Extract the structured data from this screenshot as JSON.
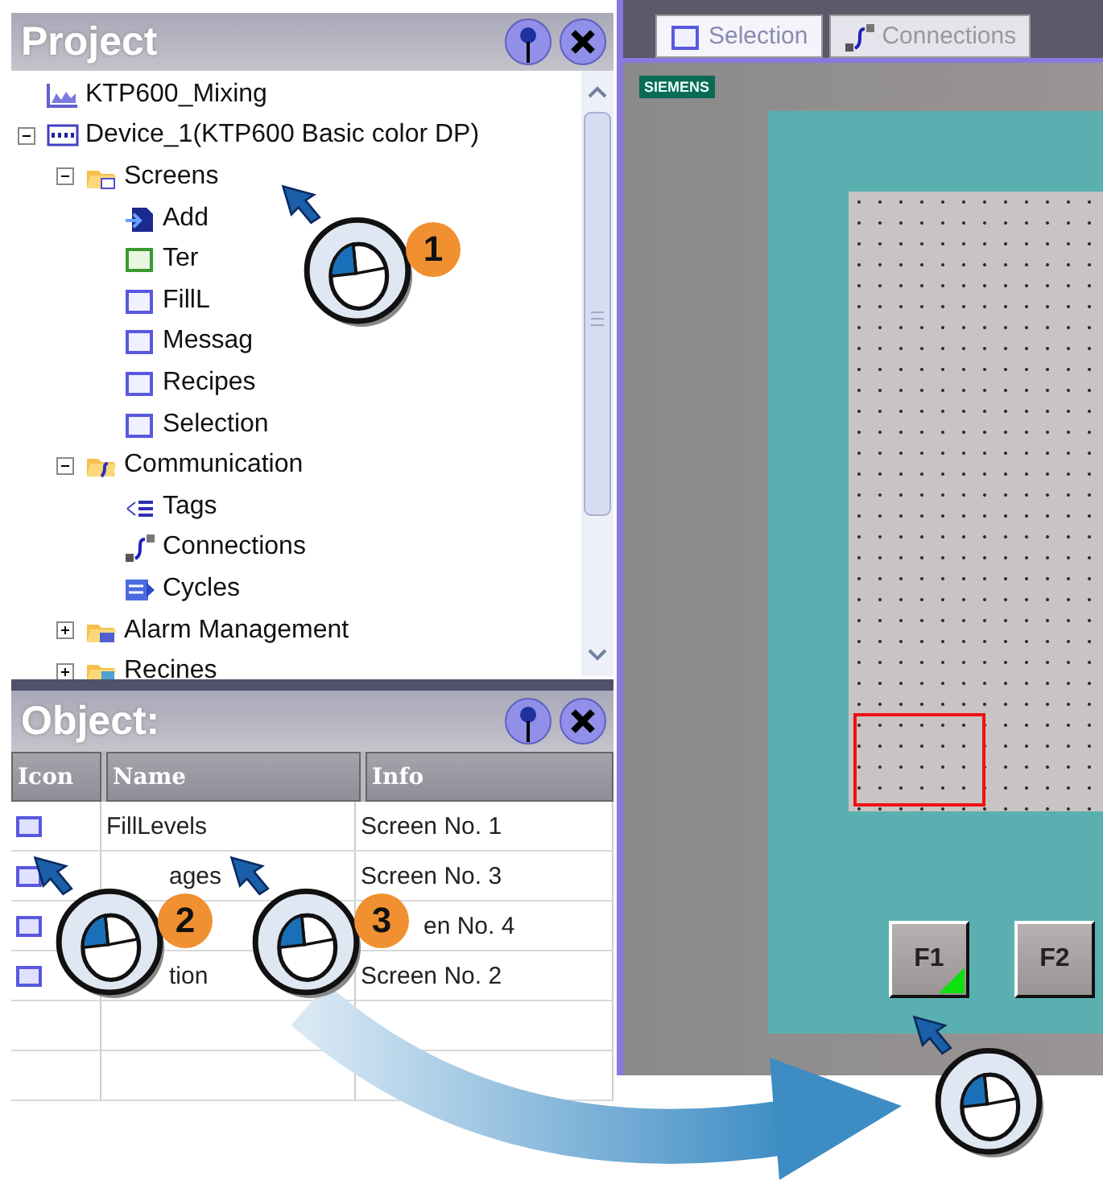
{
  "project_panel": {
    "title": "Project",
    "tree": [
      {
        "label": "KTP600_Mixing",
        "kind": "project"
      },
      {
        "label": "Device_1(KTP600 Basic color DP)",
        "kind": "device",
        "expanded": true,
        "children": [
          {
            "label": "Screens",
            "kind": "folder-screens",
            "expanded": true,
            "children": [
              {
                "label": "Add",
                "kind": "add"
              },
              {
                "label": "Ter",
                "kind": "template"
              },
              {
                "label": "FillL",
                "kind": "screen"
              },
              {
                "label": "Messag",
                "kind": "screen"
              },
              {
                "label": "Recipes",
                "kind": "screen"
              },
              {
                "label": "Selection",
                "kind": "screen"
              }
            ]
          },
          {
            "label": "Communication",
            "kind": "folder-comm",
            "expanded": true,
            "children": [
              {
                "label": "Tags",
                "kind": "tags"
              },
              {
                "label": "Connections",
                "kind": "connections"
              },
              {
                "label": "Cycles",
                "kind": "cycles"
              }
            ]
          },
          {
            "label": "Alarm Management",
            "kind": "folder-alarm",
            "expanded": false
          },
          {
            "label": "Recines",
            "kind": "folder-recipes",
            "expanded": false
          }
        ]
      }
    ]
  },
  "object_panel": {
    "title": "Object:",
    "columns": [
      "Icon",
      "Name",
      "Info"
    ],
    "rows": [
      {
        "kind": "plain",
        "name": "FillLevels",
        "info": "Screen No. 1"
      },
      {
        "kind": "name-covered",
        "name": "ages",
        "info": "Screen No. 3"
      },
      {
        "kind": "info-covered",
        "info": "en No. 4"
      },
      {
        "kind": "name-covered",
        "name": "tion",
        "info": "Screen No. 2"
      }
    ]
  },
  "editor": {
    "tabs": [
      {
        "label": "Selection",
        "kind": "screen",
        "selected": true
      },
      {
        "label": "Connections",
        "kind": "connections",
        "selected": false
      }
    ],
    "brand": "SIEMENS",
    "function_keys": [
      {
        "label": "F1",
        "marked": true
      },
      {
        "label": "F2",
        "marked": false
      }
    ]
  },
  "callouts": [
    {
      "kind": "numbered",
      "number": "1"
    },
    {
      "kind": "numbered",
      "number": "2"
    },
    {
      "kind": "numbered",
      "number": "3"
    },
    {
      "kind": "plain"
    }
  ]
}
